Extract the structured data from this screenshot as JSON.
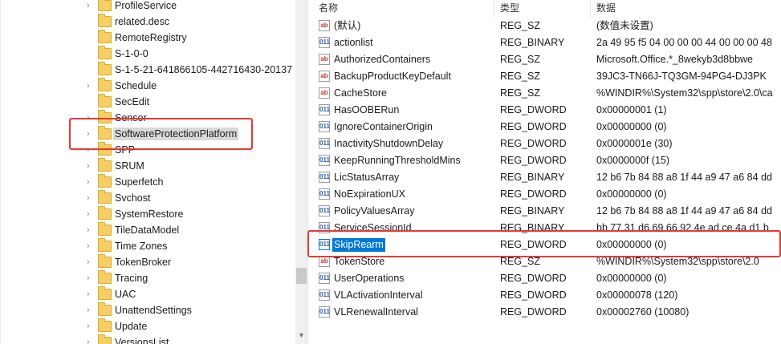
{
  "tree": {
    "items": [
      {
        "label": "ProfileService",
        "expandable": true
      },
      {
        "label": "related.desc",
        "expandable": false
      },
      {
        "label": "RemoteRegistry",
        "expandable": false
      },
      {
        "label": "S-1-0-0",
        "expandable": false
      },
      {
        "label": "S-1-5-21-641866105-442716430-20137",
        "expandable": false
      },
      {
        "label": "Schedule",
        "expandable": true
      },
      {
        "label": "SecEdit",
        "expandable": false
      },
      {
        "label": "Sensor",
        "expandable": true
      },
      {
        "label": "SoftwareProtectionPlatform",
        "expandable": true,
        "selected": true
      },
      {
        "label": "SPP",
        "expandable": true
      },
      {
        "label": "SRUM",
        "expandable": true
      },
      {
        "label": "Superfetch",
        "expandable": true
      },
      {
        "label": "Svchost",
        "expandable": true
      },
      {
        "label": "SystemRestore",
        "expandable": true
      },
      {
        "label": "TileDataModel",
        "expandable": true
      },
      {
        "label": "Time Zones",
        "expandable": true
      },
      {
        "label": "TokenBroker",
        "expandable": true
      },
      {
        "label": "Tracing",
        "expandable": true
      },
      {
        "label": "UAC",
        "expandable": true
      },
      {
        "label": "UnattendSettings",
        "expandable": true
      },
      {
        "label": "Update",
        "expandable": true
      },
      {
        "label": "VersionsList",
        "expandable": true
      }
    ],
    "chevron_icon": "chevron-right-icon",
    "folder_icon": "folder-icon"
  },
  "list": {
    "headers": {
      "name": "名称",
      "type": "类型",
      "data": "数据"
    },
    "rows": [
      {
        "name": "(默认)",
        "type": "REG_SZ",
        "data": "(数值未设置)",
        "icon": "ab"
      },
      {
        "name": "actionlist",
        "type": "REG_BINARY",
        "data": "2a 49 95 f5 04 00 00 00 44 00 00 00 48",
        "icon": "bin"
      },
      {
        "name": "AuthorizedContainers",
        "type": "REG_SZ",
        "data": "Microsoft.Office.*_8wekyb3d8bbwe",
        "icon": "ab"
      },
      {
        "name": "BackupProductKeyDefault",
        "type": "REG_SZ",
        "data": "39JC3-TN66J-TQ3GM-94PG4-DJ3PK",
        "icon": "ab"
      },
      {
        "name": "CacheStore",
        "type": "REG_SZ",
        "data": "%WINDIR%\\System32\\spp\\store\\2.0\\ca",
        "icon": "ab"
      },
      {
        "name": "HasOOBERun",
        "type": "REG_DWORD",
        "data": "0x00000001 (1)",
        "icon": "bin"
      },
      {
        "name": "IgnoreContainerOrigin",
        "type": "REG_DWORD",
        "data": "0x00000000 (0)",
        "icon": "bin"
      },
      {
        "name": "InactivityShutdownDelay",
        "type": "REG_DWORD",
        "data": "0x0000001e (30)",
        "icon": "bin"
      },
      {
        "name": "KeepRunningThresholdMins",
        "type": "REG_DWORD",
        "data": "0x0000000f (15)",
        "icon": "bin"
      },
      {
        "name": "LicStatusArray",
        "type": "REG_BINARY",
        "data": "12 b6 7b 84 88 a8 1f 44 a9 47 a6 84 dd",
        "icon": "bin"
      },
      {
        "name": "NoExpirationUX",
        "type": "REG_DWORD",
        "data": "0x00000000 (0)",
        "icon": "bin"
      },
      {
        "name": "PolicyValuesArray",
        "type": "REG_BINARY",
        "data": "12 b6 7b 84 88 a8 1f 44 a9 47 a6 84 dd",
        "icon": "bin"
      },
      {
        "name": "ServiceSessionId",
        "type": "REG_BINARY",
        "data": "bb 77 31 d6 69 66 92 4e ad ce 4a d1 b",
        "icon": "bin"
      },
      {
        "name": "SkipRearm",
        "type": "REG_DWORD",
        "data": "0x00000000 (0)",
        "icon": "bin",
        "selected": true
      },
      {
        "name": "TokenStore",
        "type": "REG_SZ",
        "data": "%WINDIR%\\System32\\spp\\store\\2.0",
        "icon": "ab"
      },
      {
        "name": "UserOperations",
        "type": "REG_DWORD",
        "data": "0x00000000 (0)",
        "icon": "bin"
      },
      {
        "name": "VLActivationInterval",
        "type": "REG_DWORD",
        "data": "0x00000078 (120)",
        "icon": "bin"
      },
      {
        "name": "VLRenewalInterval",
        "type": "REG_DWORD",
        "data": "0x00002760 (10080)",
        "icon": "bin"
      }
    ],
    "icon_glyphs": {
      "ab": "ab",
      "bin": "011"
    }
  },
  "annotations": {
    "highlight_color": "#e53935"
  },
  "colors": {
    "selection": "#0078d7",
    "tree_selection": "#d9d9d9",
    "folder": "#f5cf61"
  }
}
